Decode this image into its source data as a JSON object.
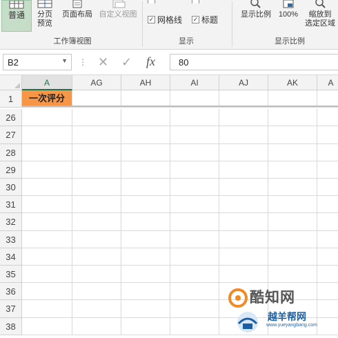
{
  "ribbon": {
    "view_buttons": {
      "normal": "普通",
      "page_break_preview": "分页\n预览",
      "page_layout": "页面布局",
      "custom_views": "自定义视图"
    },
    "group_workbook_views": "工作簿视图",
    "show": {
      "gridlines_label": "网格线",
      "headings_label": "标题",
      "gridlines_checked": true,
      "headings_checked": true
    },
    "group_show": "显示",
    "zoom": {
      "zoom_label": "显示比例",
      "hundred_label": "100%",
      "zoom_to_selection": "缩放到\n选定区域"
    },
    "group_zoom": "显示比例"
  },
  "formula_bar": {
    "name_box": "B2",
    "fx": "fx",
    "value": "80"
  },
  "sheet": {
    "columns": [
      "A",
      "AG",
      "AH",
      "AI",
      "AJ",
      "AK",
      "A"
    ],
    "rows": [
      "1",
      "26",
      "27",
      "28",
      "29",
      "30",
      "31",
      "32",
      "33",
      "34",
      "35",
      "36",
      "37",
      "38"
    ],
    "a1_value": "一次评分"
  },
  "watermark": {
    "name": "酷知网",
    "sub": "越羊帮网",
    "url": "www.yueyangbang.com"
  },
  "colors": {
    "header_fill": "#f79646",
    "selected_view": "#c6dec8",
    "accent_green": "#217346"
  }
}
